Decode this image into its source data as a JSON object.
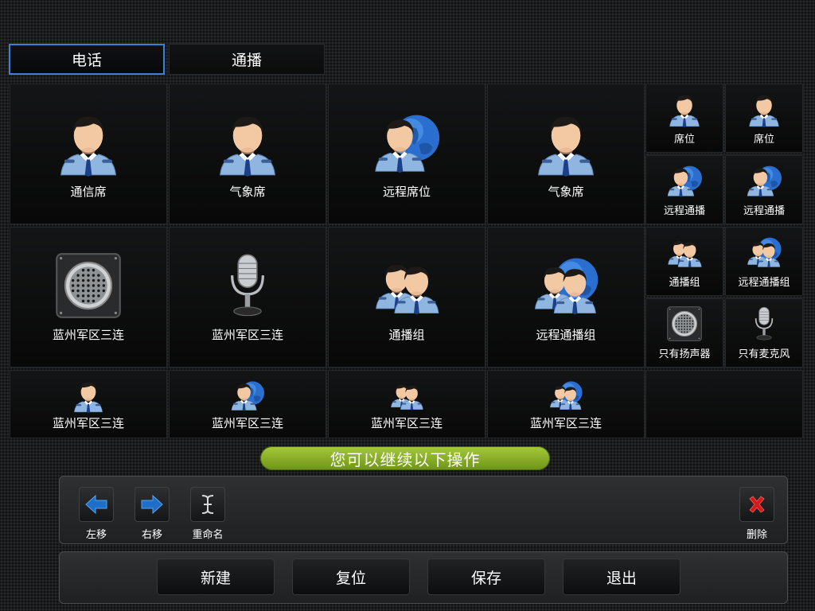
{
  "tabs": [
    {
      "label": "电话",
      "active": true
    },
    {
      "label": "通播",
      "active": false
    }
  ],
  "grid": {
    "big_row1": [
      "通信席",
      "气象席",
      "远程席位",
      "气象席"
    ],
    "big_row2": [
      "蓝州军区三连",
      "蓝州军区三连",
      "通播组",
      "远程通播组"
    ],
    "row3": [
      "蓝州军区三连",
      "蓝州军区三连",
      "蓝州军区三连",
      "蓝州军区三连"
    ],
    "small": [
      [
        "席位",
        "席位"
      ],
      [
        "远程通播",
        "远程通播"
      ],
      [
        "通播组",
        "远程通播组"
      ],
      [
        "只有扬声器",
        "只有麦克风"
      ]
    ]
  },
  "icons": {
    "big_row1": [
      "person-icon",
      "person-icon",
      "remote-person-icon",
      "person-icon"
    ],
    "big_row2": [
      "speaker-icon",
      "microphone-icon",
      "group-icon",
      "remote-group-icon"
    ],
    "row3": [
      "person-icon",
      "remote-person-icon",
      "group-icon",
      "remote-group-icon"
    ],
    "small": [
      [
        "person-icon",
        "person-icon"
      ],
      [
        "remote-person-icon",
        "remote-person-icon"
      ],
      [
        "group-icon",
        "remote-group-icon"
      ],
      [
        "speaker-icon",
        "microphone-icon"
      ]
    ]
  },
  "hint": "您可以继续以下操作",
  "toolbar": {
    "move_left": "左移",
    "move_right": "右移",
    "rename": "重命名",
    "delete": "删除"
  },
  "actions": {
    "new": "新建",
    "reset": "复位",
    "save": "保存",
    "exit": "退出"
  },
  "colors": {
    "tab_active_border": "#3a7fd8",
    "hint_bg": "#8fb02a",
    "arrow_blue": "#1f6fc8",
    "delete_red": "#d11a1a",
    "globe_blue": "#2a6fd0"
  }
}
